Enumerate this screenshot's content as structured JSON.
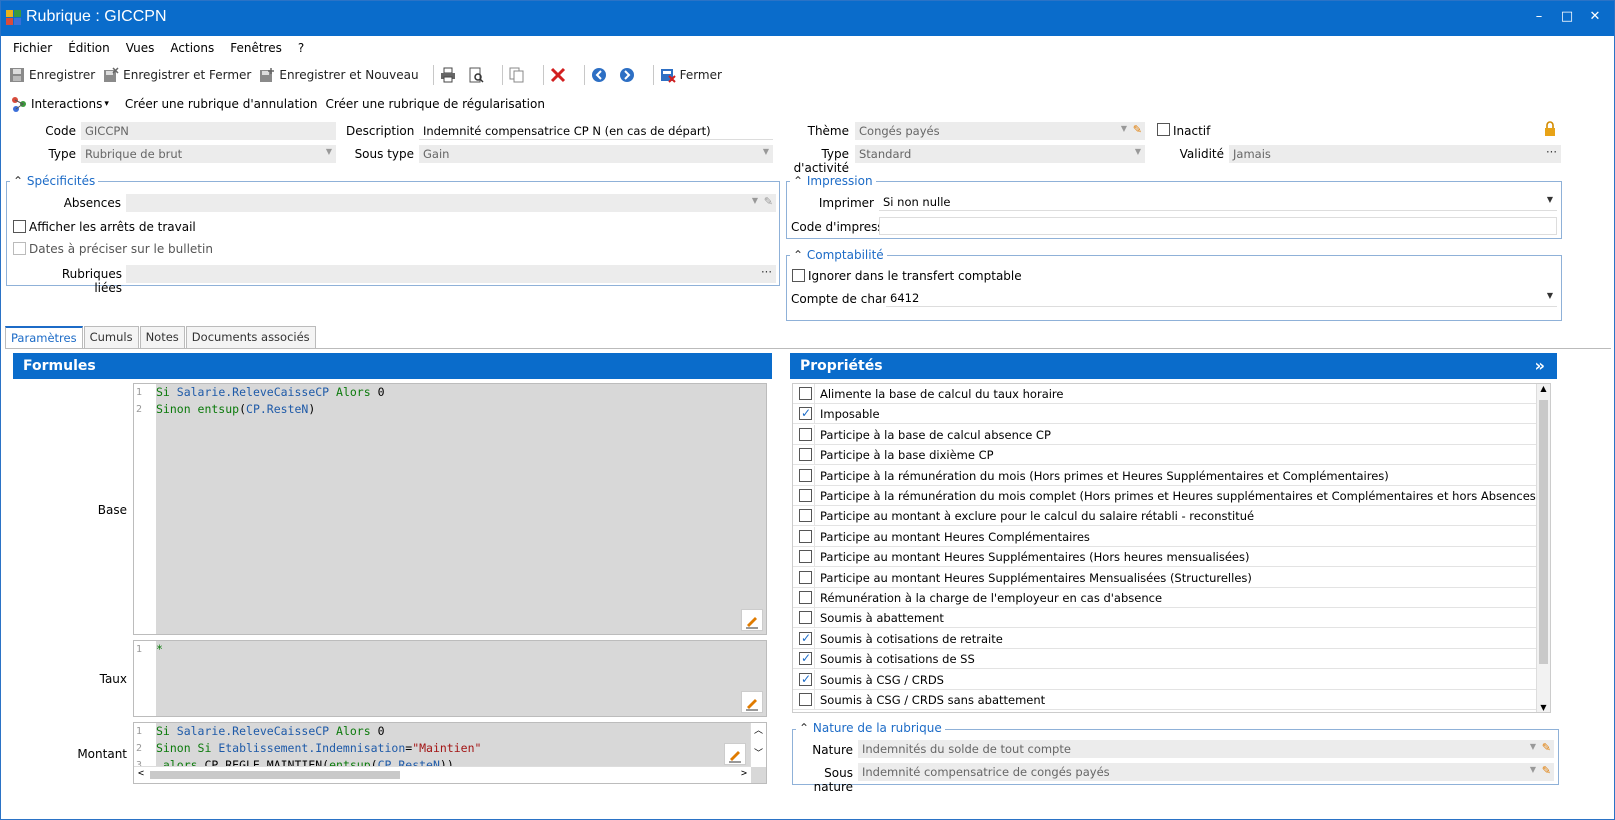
{
  "window": {
    "title": "Rubrique : GICCPN",
    "minimize": "–",
    "maximize": "□",
    "close": "✕"
  },
  "menu": [
    "Fichier",
    "Édition",
    "Vues",
    "Actions",
    "Fenêtres",
    "?"
  ],
  "toolbar": {
    "save": "Enregistrer",
    "save_close": "Enregistrer et Fermer",
    "save_new": "Enregistrer et Nouveau",
    "close": "Fermer"
  },
  "actions": {
    "interactions": "Interactions",
    "interactions_caret": "▾",
    "create_cancel": "Créer une rubrique d'annulation",
    "create_regul": "Créer une rubrique de régularisation"
  },
  "header": {
    "code_label": "Code",
    "code_value": "GICCPN",
    "type_label": "Type",
    "type_value": "Rubrique de brut",
    "desc_label": "Description",
    "desc_value": "Indemnité compensatrice CP N (en cas de départ)",
    "soustype_label": "Sous type",
    "soustype_value": "Gain",
    "theme_label": "Thème",
    "theme_value": "Congés payés",
    "activity_label": "Type d'activité",
    "activity_value": "Standard",
    "inactive_label": "Inactif",
    "validity_label": "Validité",
    "validity_value": "Jamais"
  },
  "specificites": {
    "title": "Spécificités",
    "absences_label": "Absences",
    "show_stops": "Afficher les arrêts de travail",
    "dates_preciser": "Dates à préciser sur le bulletin",
    "linked_label": "Rubriques liées"
  },
  "impression": {
    "title": "Impression",
    "print_label": "Imprimer",
    "print_value": "Si non nulle",
    "code_label": "Code d'impression"
  },
  "comptabilite": {
    "title": "Comptabilité",
    "ignore_label": "Ignorer dans le transfert comptable",
    "account_label": "Compte de charges",
    "account_value": "6412"
  },
  "tabs": [
    "Paramètres",
    "Cumuls",
    "Notes",
    "Documents associés"
  ],
  "formules": {
    "title": "Formules",
    "base_label": "Base",
    "taux_label": "Taux",
    "montant_label": "Montant",
    "taux_code": "*"
  },
  "proprietes": {
    "title": "Propriétés",
    "collapse": "»",
    "items": [
      {
        "label": "Alimente la base de calcul du taux horaire",
        "checked": false
      },
      {
        "label": "Imposable",
        "checked": true
      },
      {
        "label": "Participe à la base de calcul absence CP",
        "checked": false
      },
      {
        "label": "Participe à la base dixième CP",
        "checked": false
      },
      {
        "label": "Participe à la rémunération du mois (Hors primes et Heures Supplémentaires et Complémentaires)",
        "checked": false
      },
      {
        "label": "Participe à la rémunération du mois complet (Hors primes et Heures supplémentaires et Complémentaires et hors Absences)",
        "checked": false
      },
      {
        "label": "Participe au montant à exclure pour le calcul du salaire rétabli - reconstitué",
        "checked": false
      },
      {
        "label": "Participe au montant Heures Complémentaires",
        "checked": false
      },
      {
        "label": "Participe au montant Heures Supplémentaires (Hors heures mensualisées)",
        "checked": false
      },
      {
        "label": "Participe au montant Heures Supplémentaires Mensualisées (Structurelles)",
        "checked": false
      },
      {
        "label": "Rémunération à la charge de l'employeur en cas d'absence",
        "checked": false
      },
      {
        "label": "Soumis à abattement",
        "checked": false
      },
      {
        "label": "Soumis à cotisations de retraite",
        "checked": true
      },
      {
        "label": "Soumis à cotisations de SS",
        "checked": true
      },
      {
        "label": "Soumis à CSG / CRDS",
        "checked": true
      },
      {
        "label": "Soumis à CSG / CRDS sans abattement",
        "checked": false
      }
    ]
  },
  "nature": {
    "title": "Nature de la rubrique",
    "nature_label": "Nature",
    "nature_value": "Indemnités du solde de tout compte",
    "sousnature_label": "Sous nature",
    "sousnature_value": "Indemnité compensatrice de congés payés"
  },
  "colors": {
    "accent": "#0a6ccb",
    "group_title": "#1c6bc7"
  }
}
